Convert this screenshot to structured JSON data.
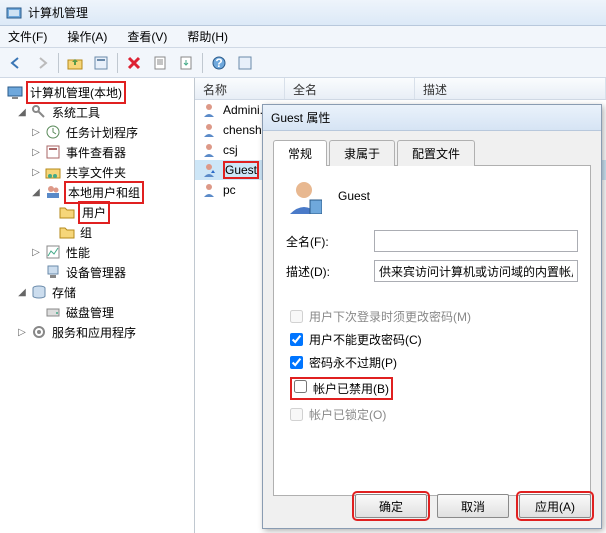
{
  "window": {
    "title": "计算机管理"
  },
  "menu": {
    "file": "文件(F)",
    "action": "操作(A)",
    "view": "查看(V)",
    "help": "帮助(H)"
  },
  "tree": {
    "root": "计算机管理(本地)",
    "systools": "系统工具",
    "tasksched": "任务计划程序",
    "eventvwr": "事件查看器",
    "shared": "共享文件夹",
    "localusers": "本地用户和组",
    "users": "用户",
    "groups": "组",
    "perf": "性能",
    "devmgr": "设备管理器",
    "storage": "存储",
    "diskmgr": "磁盘管理",
    "services": "服务和应用程序"
  },
  "list": {
    "col_name": "名称",
    "col_full": "全名",
    "col_desc": "描述",
    "rows": [
      {
        "name": "Admini..."
      },
      {
        "name": "chensh"
      },
      {
        "name": "csj"
      },
      {
        "name": "Guest"
      },
      {
        "name": "pc"
      }
    ]
  },
  "dialog": {
    "title": "Guest 属性",
    "tabs": {
      "general": "常规",
      "memberof": "隶属于",
      "profile": "配置文件"
    },
    "username": "Guest",
    "fullname_label": "全名(F):",
    "fullname_value": "",
    "desc_label": "描述(D):",
    "desc_value": "供来宾访问计算机或访问域的内置帐户",
    "chk_mustchange": "用户下次登录时须更改密码(M)",
    "chk_cannotchange": "用户不能更改密码(C)",
    "chk_neverexpire": "密码永不过期(P)",
    "chk_disabled": "帐户已禁用(B)",
    "chk_locked": "帐户已锁定(O)",
    "btn_ok": "确定",
    "btn_cancel": "取消",
    "btn_apply": "应用(A)"
  }
}
